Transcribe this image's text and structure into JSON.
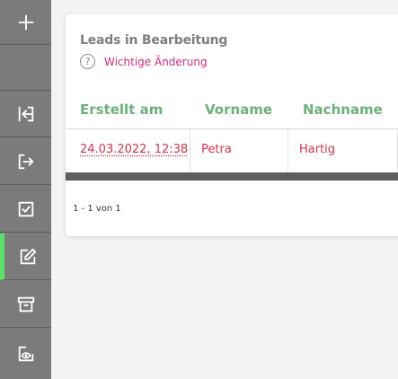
{
  "sidebar": {
    "add_icon": "plus-icon",
    "items": [
      {
        "name": "login-icon",
        "active": false
      },
      {
        "name": "logout-icon",
        "active": false
      },
      {
        "name": "checked-icon",
        "active": false
      },
      {
        "name": "edit-icon",
        "active": true
      },
      {
        "name": "archive-icon",
        "active": false
      },
      {
        "name": "view-icon",
        "active": false
      }
    ],
    "active_color": "#5ce167"
  },
  "card": {
    "title": "Leads in Bearbeitung",
    "help_icon": "?",
    "help_text": "Wichtige Änderung"
  },
  "table": {
    "columns": [
      "Erstellt am",
      "Vorname",
      "Nachname"
    ],
    "rows": [
      {
        "created": "24.03.2022, 12:38",
        "first_name": "Petra",
        "last_name": "Hartig"
      }
    ]
  },
  "pagination": {
    "summary": "1 - 1 von 1"
  },
  "colors": {
    "header_text": "#6ab27a",
    "cell_text": "#d9314a",
    "help_text": "#d4277a"
  }
}
